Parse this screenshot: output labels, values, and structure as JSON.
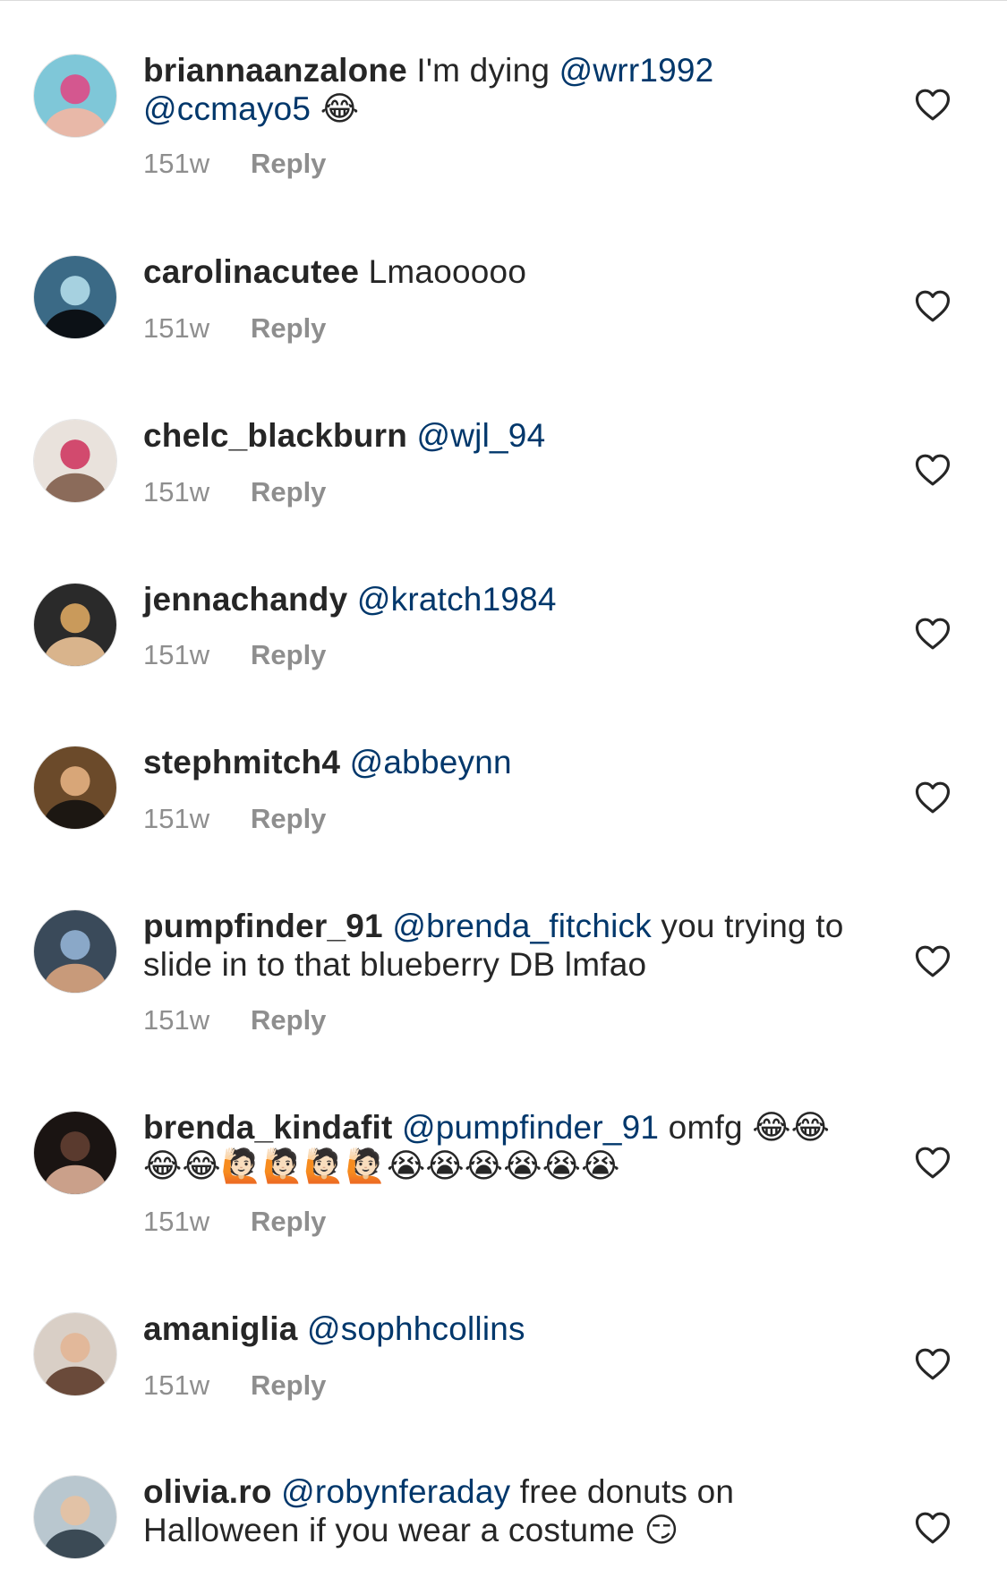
{
  "comments": [
    {
      "username": "briannaanzalone",
      "parts": [
        {
          "type": "text",
          "text": " I'm dying "
        },
        {
          "type": "mention",
          "text": "@wrr1992"
        },
        {
          "type": "break"
        },
        {
          "type": "mention",
          "text": "@ccmayo5"
        },
        {
          "type": "text",
          "text": " 😂"
        }
      ],
      "time": "151w",
      "reply": "Reply",
      "avatar_colors": [
        "#7fc7d8",
        "#e8b8a8",
        "#d4578f"
      ]
    },
    {
      "username": "carolinacutee",
      "parts": [
        {
          "type": "text",
          "text": " Lmaooooo"
        }
      ],
      "time": "151w",
      "reply": "Reply",
      "avatar_colors": [
        "#3b6a86",
        "#0c1116",
        "#a6d1e0"
      ]
    },
    {
      "username": "chelc_blackburn",
      "parts": [
        {
          "type": "text",
          "text": " "
        },
        {
          "type": "mention",
          "text": "@wjl_94"
        }
      ],
      "time": "151w",
      "reply": "Reply",
      "avatar_colors": [
        "#e9e2dc",
        "#8b6b5a",
        "#d24a6e"
      ]
    },
    {
      "username": "jennachandy",
      "parts": [
        {
          "type": "text",
          "text": " "
        },
        {
          "type": "mention",
          "text": "@kratch1984"
        }
      ],
      "time": "151w",
      "reply": "Reply",
      "avatar_colors": [
        "#2a2a2a",
        "#d9b48c",
        "#c99a5b"
      ]
    },
    {
      "username": "stephmitch4",
      "parts": [
        {
          "type": "text",
          "text": " "
        },
        {
          "type": "mention",
          "text": "@abbeynn"
        }
      ],
      "time": "151w",
      "reply": "Reply",
      "avatar_colors": [
        "#6b4a2a",
        "#1c1712",
        "#d8a678"
      ]
    },
    {
      "username": "pumpfinder_91",
      "parts": [
        {
          "type": "text",
          "text": " "
        },
        {
          "type": "mention",
          "text": "@brenda_fitchick"
        },
        {
          "type": "text",
          "text": " you trying to slide in to that blueberry DB lmfao"
        }
      ],
      "time": "151w",
      "reply": "Reply",
      "avatar_colors": [
        "#3a4a5a",
        "#c89a7a",
        "#8aa8c8"
      ]
    },
    {
      "username": "brenda_kindafit",
      "parts": [
        {
          "type": "text",
          "text": " "
        },
        {
          "type": "mention",
          "text": "@pumpfinder_91"
        },
        {
          "type": "text",
          "text": " omfg 😂😂 😂😂🙋🏻🙋🏻🙋🏻🙋🏻😭😭😭😭😭😭"
        }
      ],
      "time": "151w",
      "reply": "Reply",
      "avatar_colors": [
        "#1a1412",
        "#caa08a",
        "#5a3a2e"
      ]
    },
    {
      "username": "amaniglia",
      "parts": [
        {
          "type": "text",
          "text": " "
        },
        {
          "type": "mention",
          "text": "@sophhcollins"
        }
      ],
      "time": "151w",
      "reply": "Reply",
      "avatar_colors": [
        "#d9cfc6",
        "#6a4a3a",
        "#e2b89a"
      ]
    },
    {
      "username": "olivia.ro",
      "parts": [
        {
          "type": "text",
          "text": " "
        },
        {
          "type": "mention",
          "text": "@robynferaday"
        },
        {
          "type": "text",
          "text": " free donuts on Halloween if you wear a costume 😏"
        }
      ],
      "time": "",
      "reply": "",
      "avatar_colors": [
        "#b9c7cf",
        "#3b4a55",
        "#e2c2a6"
      ]
    }
  ],
  "icons": {
    "heart": "heart-outline-icon"
  },
  "colors": {
    "mention": "#00376b",
    "text": "#262626",
    "meta": "#8e8e8e",
    "heart_stroke": "#262626"
  }
}
